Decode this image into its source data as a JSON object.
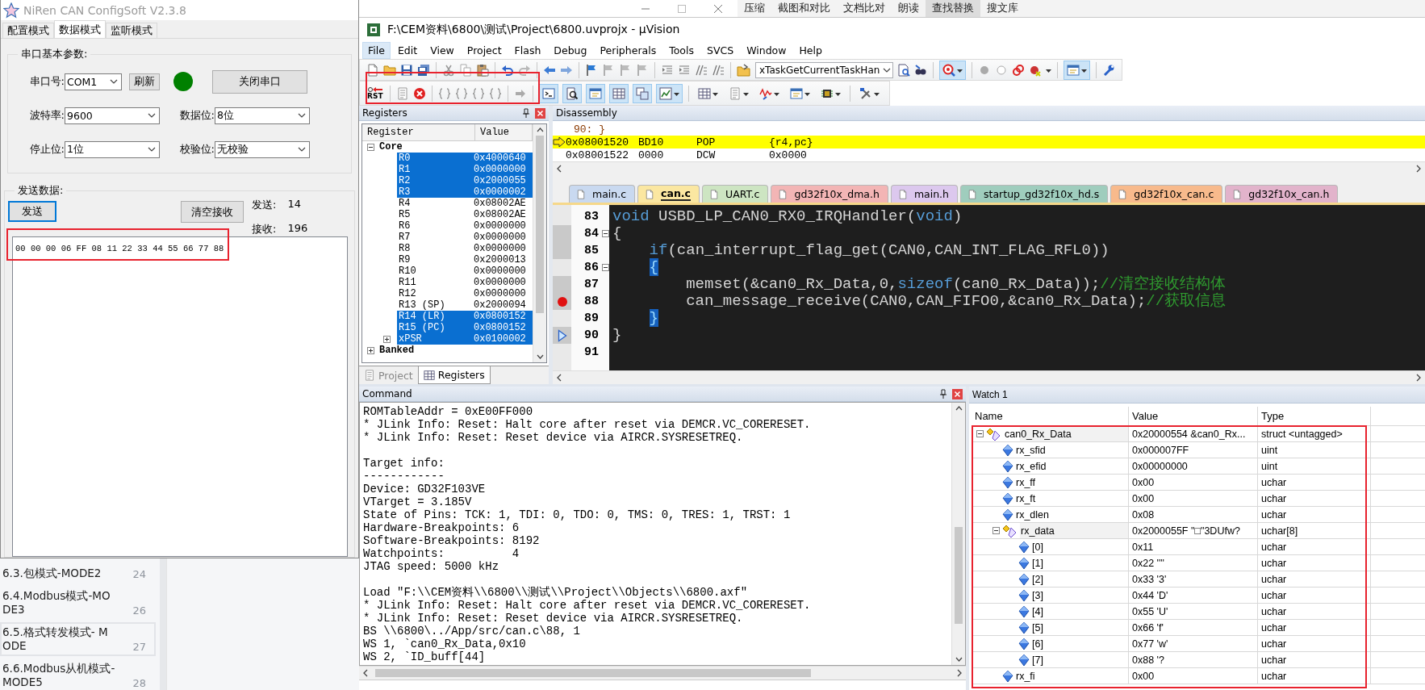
{
  "niren": {
    "title": "NiRen CAN ConfigSoft V2.3.8",
    "tabs": [
      {
        "label": "配置模式",
        "selected": false
      },
      {
        "label": "数据模式",
        "selected": true
      },
      {
        "label": "监听模式",
        "selected": false
      }
    ],
    "serial_group": {
      "title": "串口基本参数:",
      "port": {
        "label": "串口号:",
        "value": "COM1"
      },
      "refresh_button": "刷新",
      "connected": true,
      "close_button": "关闭串口",
      "baud": {
        "label": "波特率:",
        "value": "9600"
      },
      "data_bits": {
        "label": "数据位:",
        "value": "8位"
      },
      "stop_bits": {
        "label": "停止位:",
        "value": "1位"
      },
      "parity": {
        "label": "校验位:",
        "value": "无校验"
      }
    },
    "send_group": {
      "title": "发送数据:",
      "send_button": "发送",
      "clear_button": "清空接收",
      "sent_label": "发送:",
      "sent_count": "14",
      "received_label": "接收:",
      "received_count": "196",
      "received_text": "00 00 00 06 FF 08 11 22 33 44 55 66 77 88"
    }
  },
  "doc_sidebar": {
    "items": [
      {
        "title": "6.3.包模式-MODE2",
        "page": "24",
        "selected": false
      },
      {
        "title": "6.4.Modbus模式-MODE3",
        "page": "26",
        "selected": false
      },
      {
        "title": "6.5.格式转发模式- MODE",
        "page": "27",
        "selected": true
      },
      {
        "title": "6.6.Modbus从机模式-MODE5",
        "page": "28",
        "selected": false
      }
    ]
  },
  "wps_toolbar": {
    "items": [
      {
        "label": "压缩",
        "selected": false
      },
      {
        "label": "截图和对比",
        "selected": false
      },
      {
        "label": "文档比对",
        "selected": false
      },
      {
        "label": "朗读",
        "selected": false
      },
      {
        "label": "查找替换",
        "selected": true
      },
      {
        "label": "搜文库",
        "selected": false
      }
    ]
  },
  "uvision": {
    "title": "F:\\CEM资料\\6800\\测试\\Project\\6800.uvprojx - µVision",
    "menu": [
      {
        "label": "File",
        "selected": true
      },
      {
        "label": "Edit",
        "selected": false
      },
      {
        "label": "View",
        "selected": false
      },
      {
        "label": "Project",
        "selected": false
      },
      {
        "label": "Flash",
        "selected": false
      },
      {
        "label": "Debug",
        "selected": false
      },
      {
        "label": "Peripherals",
        "selected": false
      },
      {
        "label": "Tools",
        "selected": false
      },
      {
        "label": "SVCS",
        "selected": false
      },
      {
        "label": "Window",
        "selected": false
      },
      {
        "label": "Help",
        "selected": false
      }
    ],
    "toolbar": {
      "function_combo": "xTaskGetCurrentTaskHan",
      "reset_label": "RST",
      "toggles": [
        {
          "on": true
        },
        {
          "on": true
        }
      ],
      "window_buttons": [
        {
          "on": true
        },
        {
          "on": true
        },
        {
          "on": true
        },
        {
          "on": true
        },
        {
          "on": true
        },
        {
          "on": true
        },
        {
          "on": false
        },
        {
          "on": false
        },
        {
          "on": false
        },
        {
          "on": false
        },
        {
          "on": false
        },
        {
          "on": false
        }
      ]
    },
    "registers": {
      "title": "Registers",
      "columns": [
        "Register",
        "Value"
      ],
      "groups": [
        {
          "name": "Core",
          "expanded": true,
          "children": [
            {
              "name": "R0",
              "value": "0x4000640",
              "selected": true
            },
            {
              "name": "R1",
              "value": "0x0000000",
              "selected": true
            },
            {
              "name": "R2",
              "value": "0x2000055",
              "selected": true
            },
            {
              "name": "R3",
              "value": "0x0000002",
              "selected": true
            },
            {
              "name": "R4",
              "value": "0x08002AE",
              "selected": false
            },
            {
              "name": "R5",
              "value": "0x08002AE",
              "selected": false
            },
            {
              "name": "R6",
              "value": "0x0000000",
              "selected": false
            },
            {
              "name": "R7",
              "value": "0x0000000",
              "selected": false
            },
            {
              "name": "R8",
              "value": "0x0000000",
              "selected": false
            },
            {
              "name": "R9",
              "value": "0x2000013",
              "selected": false
            },
            {
              "name": "R10",
              "value": "0x0000000",
              "selected": false
            },
            {
              "name": "R11",
              "value": "0x0000000",
              "selected": false
            },
            {
              "name": "R12",
              "value": "0x0000000",
              "selected": false
            },
            {
              "name": "R13 (SP)",
              "value": "0x2000094",
              "selected": false
            },
            {
              "name": "R14 (LR)",
              "value": "0x0800152",
              "selected": true
            },
            {
              "name": "R15 (PC)",
              "value": "0x0800152",
              "selected": true
            },
            {
              "name": "xPSR",
              "value": "0x0100002",
              "selected": true,
              "expanded": false
            }
          ]
        },
        {
          "name": "Banked",
          "expanded": false
        }
      ],
      "tabs": [
        {
          "label": "Project",
          "selected": false
        },
        {
          "label": "Registers",
          "selected": true
        }
      ]
    },
    "disassembly": {
      "title": "Disassembly",
      "source_line": "90: }",
      "rows": [
        {
          "address": "0x08001520",
          "opcode": "BD10",
          "mnemonic": "POP",
          "operands": "{r4,pc}",
          "current": true
        },
        {
          "address": "0x08001522",
          "opcode": "0000",
          "mnemonic": "DCW",
          "operands": "0x0000",
          "current": false
        }
      ]
    },
    "editor": {
      "tabs": [
        {
          "label": "main.c",
          "selected": false,
          "color": "#c9d9f0"
        },
        {
          "label": "can.c",
          "selected": true,
          "color": "#fbe7a1"
        },
        {
          "label": "UART.c",
          "selected": false,
          "color": "#cde5c2"
        },
        {
          "label": "gd32f10x_dma.h",
          "selected": false,
          "color": "#f3b5b5"
        },
        {
          "label": "main.h",
          "selected": false,
          "color": "#dcc8ee"
        },
        {
          "label": "startup_gd32f10x_hd.s",
          "selected": false,
          "color": "#9fcdbd"
        },
        {
          "label": "gd32f10x_can.c",
          "selected": false,
          "color": "#f8ba8c"
        },
        {
          "label": "gd32f10x_can.h",
          "selected": false,
          "color": "#e2b3cb"
        }
      ],
      "lines": [
        {
          "number": "83",
          "executed": false,
          "fold": false,
          "breakpoint": false,
          "current": false,
          "segments": [
            {
              "kind": "keyword",
              "text": "void"
            },
            {
              "kind": "plain",
              "text": " USBD_LP_CAN0_RX0_IRQHandler("
            },
            {
              "kind": "keyword",
              "text": "void"
            },
            {
              "kind": "plain",
              "text": ")"
            }
          ]
        },
        {
          "number": "84",
          "executed": true,
          "fold": true,
          "breakpoint": false,
          "current": false,
          "segments": [
            {
              "kind": "plain",
              "text": "{"
            }
          ]
        },
        {
          "number": "85",
          "executed": true,
          "fold": false,
          "breakpoint": false,
          "current": false,
          "segments": [
            {
              "kind": "keyword",
              "text": "    if"
            },
            {
              "kind": "plain",
              "text": "(can_interrupt_flag_get(CAN0,CAN_INT_FLAG_RFL0))"
            }
          ]
        },
        {
          "number": "86",
          "executed": false,
          "fold": true,
          "breakpoint": false,
          "current": false,
          "segments": [
            {
              "kind": "brace_match",
              "text": "    {"
            }
          ]
        },
        {
          "number": "87",
          "executed": true,
          "fold": false,
          "breakpoint": false,
          "current": false,
          "segments": [
            {
              "kind": "plain",
              "text": "        memset(&can0_Rx_Data,0,"
            },
            {
              "kind": "keyword",
              "text": "sizeof"
            },
            {
              "kind": "plain",
              "text": "(can0_Rx_Data));"
            },
            {
              "kind": "comment",
              "text": "//清空接收结构体"
            }
          ]
        },
        {
          "number": "88",
          "executed": true,
          "fold": false,
          "breakpoint": true,
          "current": false,
          "segments": [
            {
              "kind": "plain",
              "text": "        can_message_receive(CAN0,CAN_FIFO0,&can0_Rx_Data);"
            },
            {
              "kind": "comment",
              "text": "//获取信息"
            }
          ]
        },
        {
          "number": "89",
          "executed": false,
          "fold": false,
          "breakpoint": false,
          "current": false,
          "segments": [
            {
              "kind": "brace_match",
              "text": "    }"
            }
          ]
        },
        {
          "number": "90",
          "executed": true,
          "fold": false,
          "breakpoint": false,
          "current": true,
          "segments": [
            {
              "kind": "plain",
              "text": "}"
            }
          ]
        },
        {
          "number": "91",
          "executed": false,
          "fold": false,
          "breakpoint": false,
          "current": false
        }
      ]
    },
    "command": {
      "title": "Command",
      "blocks": [
        {
          "lines": [
            "ROMTableAddr = 0xE00FF000",
            "* JLink Info: Reset: Halt core after reset via DEMCR.VC_CORERESET.",
            "* JLink Info: Reset: Reset device via AIRCR.SYSRESETREQ."
          ]
        },
        {
          "lines": [
            "Target info:",
            "------------",
            "Device: GD32F103VE",
            "VTarget = 3.185V",
            "State of Pins: TCK: 1, TDI: 0, TDO: 0, TMS: 0, TRES: 1, TRST: 1",
            "Hardware-Breakpoints: 6",
            "Software-Breakpoints: 8192",
            "Watchpoints:          4",
            "JTAG speed: 5000 kHz"
          ]
        },
        {
          "lines": [
            "Load \"F:\\\\CEM资料\\\\6800\\\\测试\\\\Project\\\\Objects\\\\6800.axf\"",
            "* JLink Info: Reset: Halt core after reset via DEMCR.VC_CORERESET.",
            "* JLink Info: Reset: Reset device via AIRCR.SYSRESETREQ.",
            "BS \\\\6800\\../App/src/can.c\\88, 1",
            "WS 1, `can0_Rx_Data,0x10",
            "WS 2, `ID_buff[44]"
          ]
        }
      ]
    },
    "watch": {
      "title": "Watch 1",
      "columns": [
        "Name",
        "Value",
        "Type"
      ],
      "rows": [
        {
          "name": "can0_Rx_Data",
          "value": "0x20000554 &can0_Rx...",
          "type": "struct <untagged>",
          "kind": "struct",
          "expanded": true,
          "children": [
            {
              "name": "rx_sfid",
              "value": "0x000007FF",
              "type": "uint",
              "kind": "field"
            },
            {
              "name": "rx_efid",
              "value": "0x00000000",
              "type": "uint",
              "kind": "field"
            },
            {
              "name": "rx_ff",
              "value": "0x00",
              "type": "uchar",
              "kind": "field"
            },
            {
              "name": "rx_ft",
              "value": "0x00",
              "type": "uchar",
              "kind": "field"
            },
            {
              "name": "rx_dlen",
              "value": "0x08",
              "type": "uchar",
              "kind": "field"
            },
            {
              "name": "rx_data",
              "value": "0x2000055F \"□\"3DUfw?",
              "type": "uchar[8]",
              "kind": "struct",
              "expanded": true,
              "children": [
                {
                  "name": "[0]",
                  "value": "0x11",
                  "type": "uchar",
                  "kind": "field"
                },
                {
                  "name": "[1]",
                  "value": "0x22 '\"'",
                  "type": "uchar",
                  "kind": "field"
                },
                {
                  "name": "[2]",
                  "value": "0x33 '3'",
                  "type": "uchar",
                  "kind": "field"
                },
                {
                  "name": "[3]",
                  "value": "0x44 'D'",
                  "type": "uchar",
                  "kind": "field"
                },
                {
                  "name": "[4]",
                  "value": "0x55 'U'",
                  "type": "uchar",
                  "kind": "field"
                },
                {
                  "name": "[5]",
                  "value": "0x66 'f'",
                  "type": "uchar",
                  "kind": "field"
                },
                {
                  "name": "[6]",
                  "value": "0x77 'w'",
                  "type": "uchar",
                  "kind": "field"
                },
                {
                  "name": "[7]",
                  "value": "0x88 '?",
                  "type": "uchar",
                  "kind": "field"
                }
              ]
            },
            {
              "name": "rx_fi",
              "value": "0x00",
              "type": "uchar",
              "kind": "field"
            }
          ]
        }
      ]
    }
  }
}
